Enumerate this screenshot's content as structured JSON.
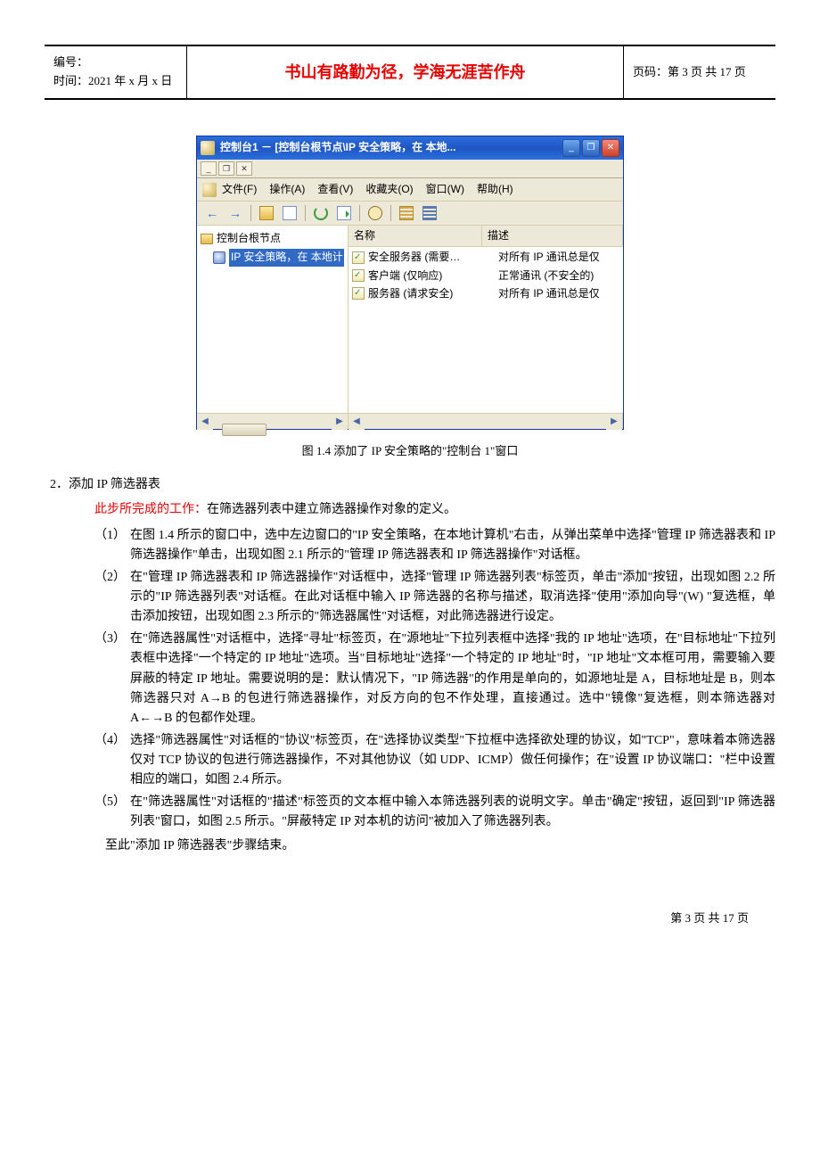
{
  "header": {
    "doc_no_label": "编号：",
    "date_label": "时间：2021 年 x 月 x 日",
    "motto": "书山有路勤为径，学海无涯苦作舟",
    "page_label": "页码：第 3 页 共 17 页"
  },
  "mmc": {
    "title": "控制台1 － [控制台根节点\\IP 安全策略，在 本地...",
    "mdi": {
      "min": "_",
      "restore": "❐",
      "close": "✕"
    },
    "win": {
      "min": "_",
      "max": "❐",
      "close": "✕"
    },
    "menu": {
      "file": "文件(F)",
      "action": "操作(A)",
      "view": "查看(V)",
      "favorites": "收藏夹(O)",
      "window": "窗口(W)",
      "help": "帮助(H)"
    },
    "toolbar": {
      "back": "←",
      "fwd": "→"
    },
    "tree": {
      "root": "控制台根节点",
      "policy": "IP 安全策略，在 本地计"
    },
    "list": {
      "col_name": "名称",
      "col_desc": "描述",
      "rows": [
        {
          "name": "安全服务器 (需要…",
          "desc": "对所有 IP 通讯总是仅"
        },
        {
          "name": "客户端 (仅响应)",
          "desc": "正常通讯 (不安全的)"
        },
        {
          "name": "服务器 (请求安全)",
          "desc": "对所有 IP 通讯总是仅"
        }
      ]
    },
    "scroll": {
      "left": "◀",
      "right": "▶"
    }
  },
  "figcaption": "图 1.4  添加了 IP 安全策略的\"控制台 1\"窗口",
  "section_title": "2．添加 IP 筛选器表",
  "step_intro_red": "此步所完成的工作：",
  "step_intro_text": "在筛选器列表中建立筛选器操作对象的定义。",
  "steps": [
    {
      "num": "（1）",
      "txt": "在图 1.4 所示的窗口中，选中左边窗口的\"IP 安全策略，在本地计算机\"右击，从弹出菜单中选择\"管理 IP 筛选器表和 IP 筛选器操作\"单击，出现如图 2.1 所示的\"管理 IP 筛选器表和 IP 筛选器操作\"对话框。"
    },
    {
      "num": "（2）",
      "txt": "在\"管理 IP 筛选器表和 IP 筛选器操作\"对话框中，选择\"管理 IP 筛选器列表\"标签页，单击\"添加\"按钮，出现如图 2.2 所示的\"IP 筛选器列表\"对话框。在此对话框中输入 IP 筛选器的名称与描述，取消选择\"使用\"添加向导\"(W) \"复选框，单击添加按钮，出现如图 2.3 所示的\"筛选器属性\"对话框，对此筛选器进行设定。"
    },
    {
      "num": "（3）",
      "txt": "在\"筛选器属性\"对话框中，选择\"寻址\"标签页，在\"源地址\"下拉列表框中选择\"我的 IP 地址\"选项，在\"目标地址\"下拉列表框中选择\"一个特定的 IP 地址\"选项。当\"目标地址\"选择\"一个特定的 IP 地址\"时，\"IP 地址\"文本框可用，需要输入要屏蔽的特定 IP 地址。需要说明的是：默认情况下，\"IP 筛选器\"的作用是单向的，如源地址是 A，目标地址是 B，则本筛选器只对 A→B 的包进行筛选器操作，对反方向的包不作处理，直接通过。选中\"镜像\"复选框，则本筛选器对 A←→B 的包都作处理。"
    },
    {
      "num": "（4）",
      "txt": "选择\"筛选器属性\"对话框的\"协议\"标签页，在\"选择协议类型\"下拉框中选择欲处理的协议，如\"TCP\"，意味着本筛选器仅对 TCP 协议的包进行筛选器操作，不对其他协议（如 UDP、ICMP）做任何操作；在\"设置 IP 协议端口：\"栏中设置相应的端口，如图 2.4 所示。"
    },
    {
      "num": "（5）",
      "txt": "在\"筛选器属性\"对话框的\"描述\"标签页的文本框中输入本筛选器列表的说明文字。单击\"确定\"按钮，返回到\"IP 筛选器列表\"窗口，如图 2.5 所示。\"屏蔽特定 IP 对本机的访问\"被加入了筛选器列表。"
    }
  ],
  "endline": "至此\"添加 IP 筛选器表\"步骤结束。",
  "footer": "第 3 页 共 17 页"
}
